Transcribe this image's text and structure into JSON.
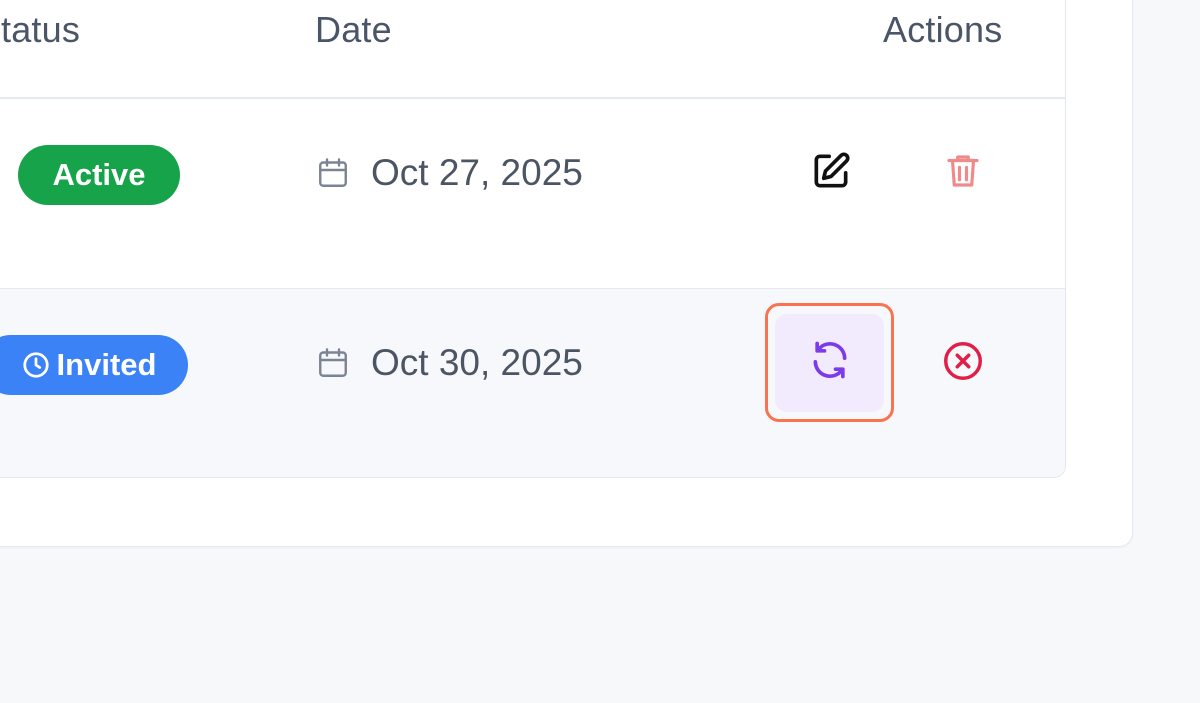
{
  "table": {
    "headers": {
      "status": "tatus",
      "date": "Date",
      "actions": "Actions"
    },
    "rows": [
      {
        "status": "Active",
        "status_color": "#16a34a",
        "date": "Oct 27, 2025",
        "actions": [
          "edit-icon",
          "trash-icon"
        ]
      },
      {
        "status": "Invited",
        "status_color": "#3b82f6",
        "date": "Oct 30, 2025",
        "actions": [
          "refresh-icon",
          "x-circle-icon"
        ]
      }
    ]
  },
  "colors": {
    "highlight_border": "#f97350",
    "resend_bg": "#f1ebfd",
    "resend_icon": "#7c3aed",
    "delete_icon": "#f08a8a",
    "cancel_icon": "#e11d48"
  }
}
